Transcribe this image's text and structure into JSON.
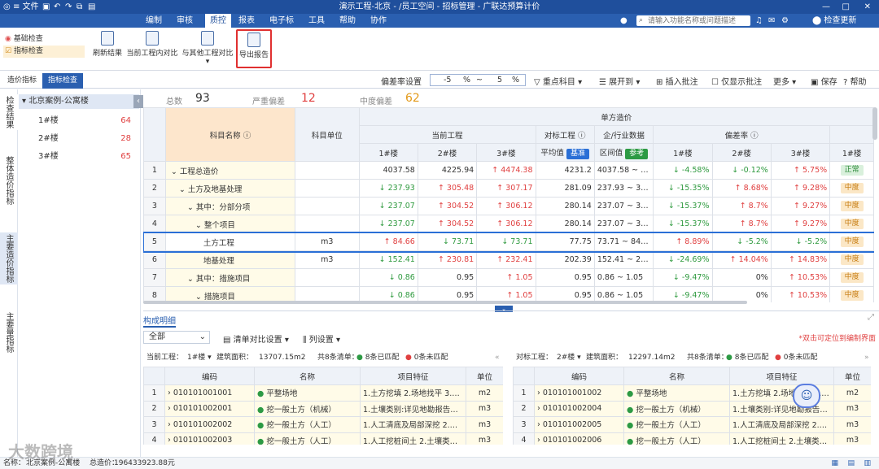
{
  "titlebar": {
    "file": "≡ 文件",
    "title": "演示工程-北京 - /员工空间 - 招标管理 - 广联达预算计价",
    "search_placeholder": "请输入功能名称或问题描述",
    "update": "检查更新"
  },
  "menubar": {
    "items": [
      "编制",
      "审核",
      "质控",
      "报表",
      "电子标",
      "工具",
      "帮助",
      "协作"
    ],
    "active": "质控"
  },
  "ribbon": {
    "left": [
      "基础检查",
      "指标检查"
    ],
    "buttons": [
      "刷新结果",
      "当前工程内对比",
      "与其他工程对比",
      "导出报告"
    ]
  },
  "subtabs": {
    "tabs": [
      "造价指标",
      "指标检查"
    ],
    "deviation_label": "偏差率设置",
    "dev_low": "-5",
    "dev_pct1": "%",
    "dev_tilde": "~",
    "dev_high": "5",
    "dev_pct2": "%",
    "filter": "重点科目",
    "expand": "展开到",
    "insert": "插入批注",
    "only": "仅显示批注",
    "more": "更多",
    "save": "保存",
    "help": "帮助"
  },
  "side": [
    "检查结果",
    "整体造价指标",
    "主要造价指标",
    "主要量指标"
  ],
  "tree": {
    "root": "北京案例-公寓楼",
    "items": [
      {
        "name": "1#楼",
        "count": "64"
      },
      {
        "name": "2#楼",
        "count": "28"
      },
      {
        "name": "3#楼",
        "count": "65"
      }
    ]
  },
  "summary": {
    "total_label": "总数",
    "total": "93",
    "severe_label": "严重偏差",
    "severe": "12",
    "medium_label": "中度偏差",
    "medium": "62"
  },
  "grid": {
    "h_name": "科目名称",
    "h_unit": "科目单位",
    "h_unit_price": "单方造价",
    "h_cur": "当前工程",
    "h_ref": "对标工程",
    "h_ind": "企/行业数据",
    "h_dev": "偏差率",
    "h_b1": "1#楼",
    "h_b2": "2#楼",
    "h_b3": "3#楼",
    "h_avg": "平均值",
    "h_base": "基准",
    "h_range": "区间值",
    "h_ref_tag": "参考",
    "rows": [
      {
        "no": "1",
        "name": "工程总造价",
        "unit": "",
        "c1": "4037.58",
        "c2": "4225.94",
        "c3": "4474.38",
        "avg": "4231.2",
        "range": "4037.58 ~ 44...",
        "d1": "-4.58%",
        "d2": "-0.12%",
        "d3": "5.75%",
        "s1": "正常"
      },
      {
        "no": "2",
        "name": "土方及地基处理",
        "unit": "",
        "c1": "237.93",
        "c2": "305.48",
        "c3": "307.17",
        "avg": "281.09",
        "range": "237.93 ~ 307...",
        "d1": "-15.35%",
        "d2": "8.68%",
        "d3": "9.28%",
        "s1": "中度"
      },
      {
        "no": "3",
        "name": "其中：分部分项",
        "unit": "",
        "c1": "237.07",
        "c2": "304.52",
        "c3": "306.12",
        "avg": "280.14",
        "range": "237.07 ~ 306...",
        "d1": "-15.37%",
        "d2": "8.7%",
        "d3": "9.27%",
        "s1": "中度"
      },
      {
        "no": "4",
        "name": "整个项目",
        "unit": "",
        "c1": "237.07",
        "c2": "304.52",
        "c3": "306.12",
        "avg": "280.14",
        "range": "237.07 ~ 306...",
        "d1": "-15.37%",
        "d2": "8.7%",
        "d3": "9.27%",
        "s1": "中度"
      },
      {
        "no": "5",
        "name": "土方工程",
        "unit": "m3",
        "c1": "84.66",
        "c2": "73.71",
        "c3": "73.71",
        "avg": "77.75",
        "range": "73.71 ~ 84.66",
        "d1": "8.89%",
        "d2": "-5.2%",
        "d3": "-5.2%",
        "s1": "中度"
      },
      {
        "no": "6",
        "name": "地基处理",
        "unit": "m3",
        "c1": "152.41",
        "c2": "230.81",
        "c3": "232.41",
        "avg": "202.39",
        "range": "152.41 ~ 232...",
        "d1": "-24.69%",
        "d2": "14.04%",
        "d3": "14.83%",
        "s1": "中度"
      },
      {
        "no": "7",
        "name": "其中：措施项目",
        "unit": "",
        "c1": "0.86",
        "c2": "0.95",
        "c3": "1.05",
        "avg": "0.95",
        "range": "0.86 ~ 1.05",
        "d1": "-9.47%",
        "d2": "0%",
        "d3": "10.53%",
        "s1": "中度"
      },
      {
        "no": "8",
        "name": "措施项目",
        "unit": "",
        "c1": "0.86",
        "c2": "0.95",
        "c3": "1.05",
        "avg": "0.95",
        "range": "0.86 ~ 1.05",
        "d1": "-9.47%",
        "d2": "0%",
        "d3": "10.53%",
        "s1": "中度"
      }
    ]
  },
  "detail": {
    "tab": "构成明细",
    "all": "全部",
    "compare": "清单对比设置",
    "cols": "列设置",
    "hint": "*双击可定位到编制界面",
    "left_hdr": {
      "cur": "当前工程：",
      "b": "1#楼",
      "area_label": "建筑面积：",
      "area": "13707.15m2",
      "total": "共8条清单：",
      "matched": "8条已匹配",
      "unmatched": "0条未匹配"
    },
    "right_hdr": {
      "cur": "对标工程：",
      "b": "2#楼",
      "area_label": "建筑面积：",
      "area": "12297.14m2",
      "total": "共8条清单：",
      "matched": "8条已匹配",
      "unmatched": "0条未匹配"
    },
    "cols_h": [
      "编码",
      "名称",
      "项目特征",
      "单位"
    ],
    "left_rows": [
      {
        "no": "1",
        "code": "010101001001",
        "name": "平整场地",
        "feat": "1.土方挖填 2.场地找平 3.运输 4....",
        "unit": "m2"
      },
      {
        "no": "2",
        "code": "010101002001",
        "name": "挖一般土方（机械）",
        "feat": "1.土壤类别:详见地勘报告或现勘现...",
        "unit": "m3"
      },
      {
        "no": "3",
        "code": "010101002002",
        "name": "挖一般土方（人工）",
        "feat": "1.人工清底及局部深挖 2.土壤类别...",
        "unit": "m3"
      },
      {
        "no": "4",
        "code": "010101002003",
        "name": "挖一般土方（人工）",
        "feat": "1.人工挖桩间土 2.土壤类别:详见...",
        "unit": "m3"
      }
    ],
    "right_rows": [
      {
        "no": "1",
        "code": "010101001002",
        "name": "平整场地",
        "feat": "1.土方挖填 2.场地找平 3.运...",
        "unit": "m2"
      },
      {
        "no": "2",
        "code": "010101002004",
        "name": "挖一般土方（机械）",
        "feat": "1.土壤类别:详见地勘报告或现...",
        "unit": "m3"
      },
      {
        "no": "3",
        "code": "010101002005",
        "name": "挖一般土方（人工）",
        "feat": "1.人工清底及局部深挖 2.土壤类别...",
        "unit": "m3"
      },
      {
        "no": "4",
        "code": "010101002006",
        "name": "挖一般土方（人工）",
        "feat": "1.人工挖桩间土 2.土壤类别:详见...",
        "unit": "m3"
      }
    ]
  },
  "status": {
    "name_label": "名称：",
    "name": "北京案例-公寓楼",
    "total_label": "总造价：",
    "total": "196433923.88元",
    "watermark": "大数跨境"
  }
}
